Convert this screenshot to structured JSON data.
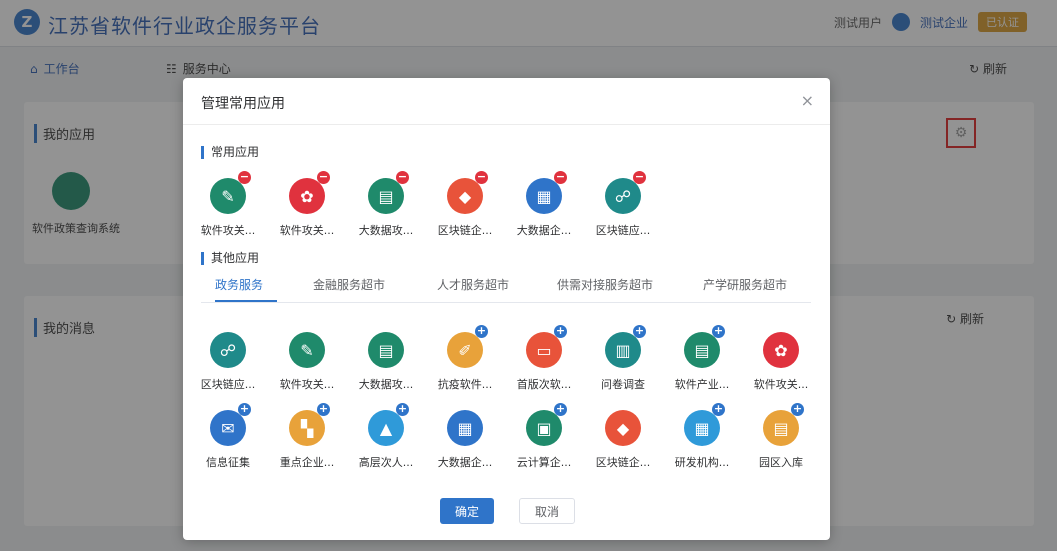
{
  "header": {
    "site_title": "江苏省软件行业政企服务平台",
    "user": "测试用户",
    "company": "测试企业",
    "tag": "已认证"
  },
  "nav": {
    "home": "工作台",
    "service": "服务中心",
    "refresh": "刷新"
  },
  "panels": {
    "my_apps": "我的应用",
    "bg_app_name": "软件政策查询系统",
    "my_messages": "我的消息",
    "refresh": "刷新"
  },
  "modal": {
    "title": "管理常用应用",
    "close": "×",
    "common_section": "常用应用",
    "other_section": "其他应用",
    "common_apps": [
      {
        "label": "软件攻关...",
        "icon": "edit-icon",
        "color": "#1f8a6b"
      },
      {
        "label": "软件攻关...",
        "icon": "grid-icon",
        "color": "#e0323e"
      },
      {
        "label": "大数据攻...",
        "icon": "document-icon",
        "color": "#1f8a6b"
      },
      {
        "label": "区块链企...",
        "icon": "diamond-icon",
        "color": "#e8533a"
      },
      {
        "label": "大数据企...",
        "icon": "building-icon",
        "color": "#2f74c9"
      },
      {
        "label": "区块链应...",
        "icon": "network-icon",
        "color": "#1f8a8a"
      }
    ],
    "tabs": [
      "政务服务",
      "金融服务超市",
      "人才服务超市",
      "供需对接服务超市",
      "产学研服务超市"
    ],
    "other_apps": [
      {
        "label": "区块链应...",
        "icon": "network-icon",
        "color": "#1f8a8a",
        "badge": false
      },
      {
        "label": "软件攻关...",
        "icon": "edit-icon",
        "color": "#1f8a6b",
        "badge": false
      },
      {
        "label": "大数据攻...",
        "icon": "document-icon",
        "color": "#1f8a6b",
        "badge": false
      },
      {
        "label": "抗疫软件...",
        "icon": "pen-icon",
        "color": "#e8a23a",
        "badge": true
      },
      {
        "label": "首版次软...",
        "icon": "window-icon",
        "color": "#e8533a",
        "badge": true
      },
      {
        "label": "问卷调查",
        "icon": "clipboard-icon",
        "color": "#1f8a8a",
        "badge": true
      },
      {
        "label": "软件产业...",
        "icon": "report-icon",
        "color": "#1f8a6b",
        "badge": true
      },
      {
        "label": "软件攻关...",
        "icon": "grid-icon",
        "color": "#e0323e",
        "badge": false
      },
      {
        "label": "信息征集",
        "icon": "mail-icon",
        "color": "#2f74c9",
        "badge": true
      },
      {
        "label": "重点企业...",
        "icon": "chart-icon",
        "color": "#e8a23a",
        "badge": true
      },
      {
        "label": "高层次人...",
        "icon": "graduation-icon",
        "color": "#2f9ad9",
        "badge": true
      },
      {
        "label": "大数据企...",
        "icon": "building-icon",
        "color": "#2f74c9",
        "badge": false
      },
      {
        "label": "云计算企...",
        "icon": "monitor-icon",
        "color": "#1f8a6b",
        "badge": true
      },
      {
        "label": "区块链企...",
        "icon": "diamond-icon",
        "color": "#e8533a",
        "badge": false
      },
      {
        "label": "研发机构...",
        "icon": "lab-icon",
        "color": "#2f9ad9",
        "badge": true
      },
      {
        "label": "园区入库",
        "icon": "file-icon",
        "color": "#e8a23a",
        "badge": true
      }
    ],
    "confirm": "确定",
    "cancel": "取消"
  }
}
